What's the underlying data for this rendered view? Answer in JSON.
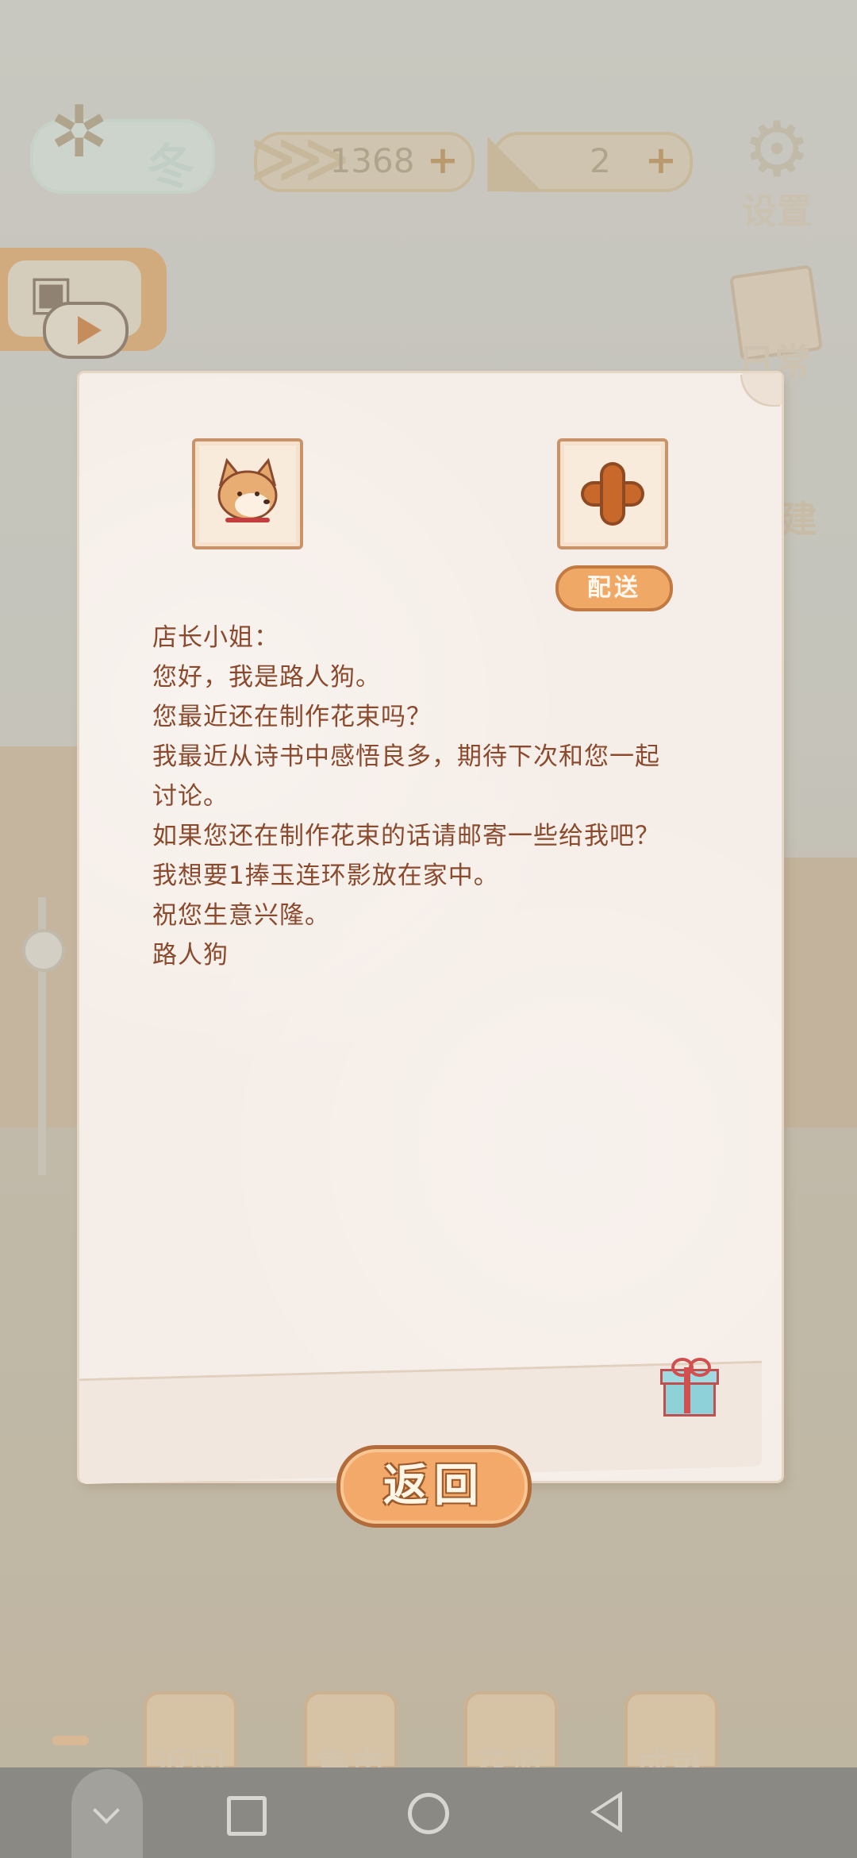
{
  "hud": {
    "season_label": "冬",
    "fish_count": "1368",
    "cheese_count": "2",
    "settings_label": "设置",
    "daily_label": "日常",
    "build_label": "建"
  },
  "letter": {
    "deliver_label": "配送",
    "lines": [
      "店长小姐：",
      "您好，我是路人狗。",
      "您最近还在制作花束吗？",
      "我最近从诗书中感悟良多，期待下次和您一起",
      "讨论。",
      "如果您还在制作花束的话请邮寄一些给我吧？",
      "我想要1捧玉连环影放在家中。",
      "祝您生意兴隆。",
      "路人狗"
    ]
  },
  "return_label": "返回",
  "bottom_menu": {
    "items": [
      {
        "label": "返回"
      },
      {
        "label": "集市"
      },
      {
        "label": "花篮"
      },
      {
        "label": "成就"
      }
    ]
  },
  "colors": {
    "accent": "#f2a96a",
    "letter_text": "#8a4a2e",
    "paper": "#f5ede7"
  },
  "icons": [
    "season-winter-icon",
    "fish-bone-icon",
    "cheese-icon",
    "gear-icon",
    "bag-icon",
    "play-icon",
    "dog-avatar-icon",
    "plus-icon",
    "gift-icon"
  ]
}
